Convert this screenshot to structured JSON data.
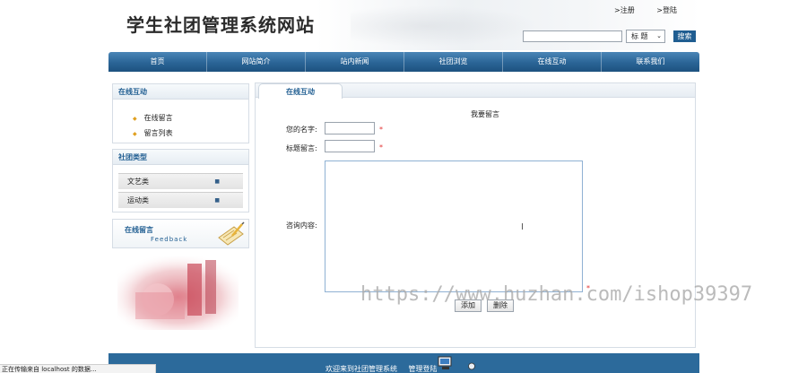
{
  "header": {
    "site_title": "学生社团管理系统网站",
    "top_links": [
      ">注册",
      ">登陆"
    ],
    "search": {
      "value": "",
      "select_value": "标  题",
      "button": "搜索"
    }
  },
  "nav": [
    "首页",
    "网站简介",
    "站内新闻",
    "社团浏览",
    "在线互动",
    "联系我们"
  ],
  "sidebar": {
    "online_title": "在线互动",
    "online_items": [
      "在线留言",
      "留言列表"
    ],
    "category_title": "社团类型",
    "categories": [
      "文艺类",
      "运动类"
    ],
    "feedback_title": "在线留言",
    "feedback_sub": "Feedback"
  },
  "main": {
    "tab": "在线互动",
    "heading": "我要留言",
    "fields": {
      "name_label": "您的名字:",
      "subject_label": "标题留言:",
      "content_label": "咨询内容:",
      "required_mark": "*"
    },
    "buttons": {
      "add": "添加",
      "delete": "删除"
    }
  },
  "footer": {
    "welcome": "欢迎来到社团管理系统",
    "admin_login": "管理登陆"
  },
  "status": "正在传输来自 localhost 的数据...",
  "watermark": "https://www.huzhan.com/ishop39397",
  "colors": {
    "brand_blue": "#2a6496",
    "accent_red": "#e23232",
    "bullet": "#e0a020"
  }
}
